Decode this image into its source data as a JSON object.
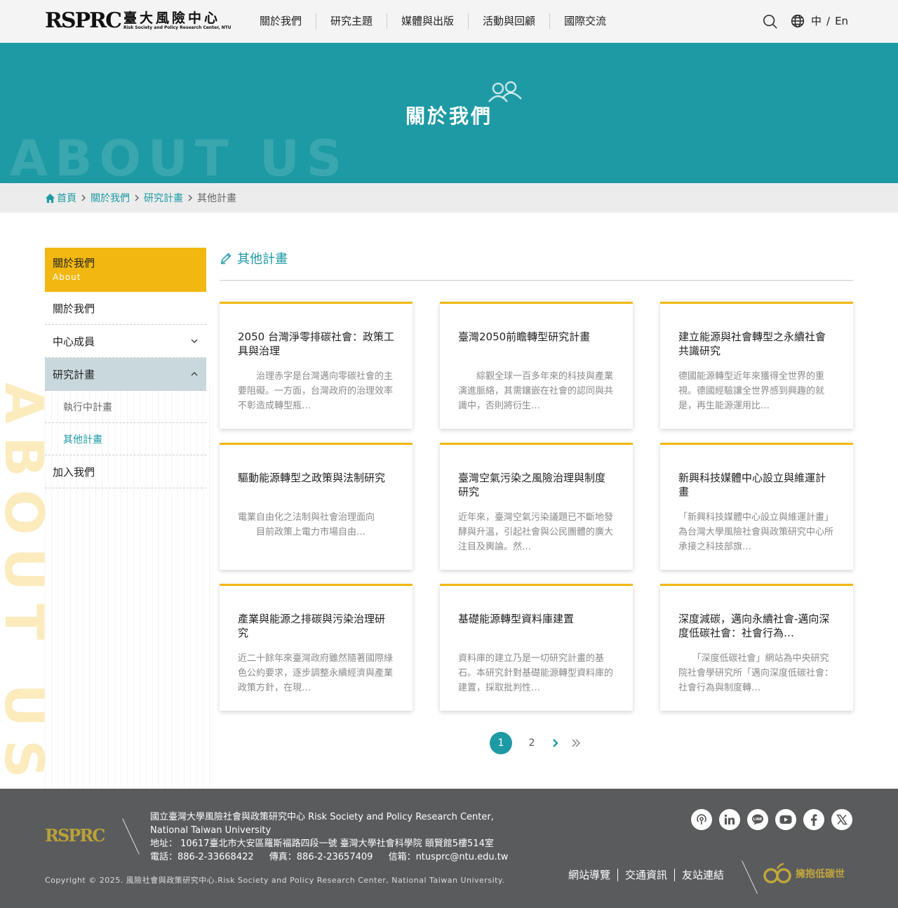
{
  "header": {
    "logo_mark": "RSPRC",
    "logo_cn": "臺大風險中心",
    "logo_en": "Risk Society and Policy Research Center, NTU",
    "nav": [
      "關於我們",
      "研究主題",
      "媒體與出版",
      "活動與回顧",
      "國際交流"
    ],
    "lang_cn": "中",
    "lang_sep": "/",
    "lang_en": "En"
  },
  "banner": {
    "title": "關於我們",
    "bg_text": "ABOUT US"
  },
  "breadcrumb": {
    "home": "首頁",
    "about": "關於我們",
    "research": "研究計畫",
    "current": "其他計畫"
  },
  "sidebar": {
    "head_title": "關於我們",
    "head_sub": "About",
    "items": {
      "about": "關於我們",
      "members": "中心成員",
      "research": "研究計畫",
      "ongoing": "執行中計畫",
      "other": "其他計畫",
      "join": "加入我們"
    },
    "deco_text": "ABOUT US"
  },
  "main": {
    "title": "其他計畫",
    "cards": [
      {
        "title": "2050 台灣淨零排碳社會：政策工具與治理",
        "desc": "　　治理赤字是台灣邁向零碳社會的主要阻礙。一方面，台灣政府的治理效率不彰造成轉型瓶…"
      },
      {
        "title": "臺灣2050前瞻轉型研究計畫",
        "desc": "　　綜觀全球一百多年來的科技與產業演進脈絡，其需鑲嵌在社會的認同與共識中，否則將衍生…"
      },
      {
        "title": "建立能源與社會轉型之永續社會共識研究",
        "desc": "德國能源轉型近年來獲得全世界的重視。德國經驗讓全世界感到興趣的就是，再生能源運用比…"
      },
      {
        "title": "驅動能源轉型之政策與法制研究",
        "desc": "電業自由化之法制與社會治理面向\n　　目前政策上電力市場自由…"
      },
      {
        "title": "臺灣空氣污染之風險治理與制度研究",
        "desc": "近年來，臺灣空氣污染議題已不斷地發酵與升溫，引起社會與公民團體的廣大注目及輿論。然…"
      },
      {
        "title": "新興科技媒體中心設立與維運計畫",
        "desc": "「新興科技媒體中心設立與維運計畫」為台灣大學風險社會與政策研究中心所承接之科技部旗…"
      },
      {
        "title": "產業與能源之排碳與污染治理研究",
        "desc": "近二十餘年來臺灣政府雖然隨著國際綠色公約要求，逐步調整永續經濟與產業政策方針，在現…"
      },
      {
        "title": "基礎能源轉型資料庫建置",
        "desc": "資料庫的建立乃是一切研究計畫的基石。本研究針對基礎能源轉型資料庫的建置，採取批判性…"
      },
      {
        "title": "深度減碳，邁向永續社會-邁向深度低碳社會：社會行為…",
        "desc": "　　「深度低碳社會」網站為中央研究院社會學研究所「邁向深度低碳社會：社會行為與制度轉…"
      }
    ]
  },
  "pagination": {
    "pages": [
      "1",
      "2"
    ],
    "current": "1"
  },
  "footer": {
    "logo": "RSPRC",
    "org_line1": "國立臺灣大學風險社會與政策研究中心 Risk Society and Policy Research Center,",
    "org_line2": "National Taiwan University",
    "address": "地址：  10617臺北市大安區羅斯福路四段一號 臺灣大學社會科學院 頤賢館5樓514室",
    "phone": "電話：886-2-33668422",
    "fax": "傳真：886-2-23657409",
    "email": "信箱：ntusprc@ntu.edu.tw",
    "copyright": "Copyright © 2025. 風險社會與政策研究中心.Risk Society and Policy Research Center, National Taiwan University.",
    "links": [
      "網站導覽",
      "交通資訊",
      "友站連結"
    ],
    "carbon_logo": "擁抱低碳世",
    "social": [
      "podcast-icon",
      "linkedin-icon",
      "line-icon",
      "youtube-icon",
      "facebook-icon",
      "x-icon"
    ]
  },
  "colors": {
    "teal": "#1d9aa4",
    "yellow": "#f2b811",
    "footer_bg": "#5a5b5d"
  }
}
